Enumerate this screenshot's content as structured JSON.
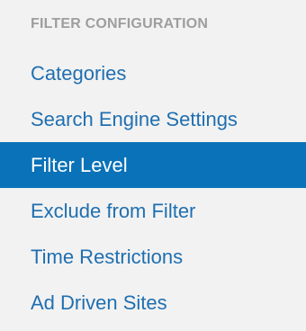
{
  "filter_menu": {
    "heading": "FILTER CONFIGURATION",
    "items": [
      {
        "label": "Categories",
        "active": false
      },
      {
        "label": "Search Engine Settings",
        "active": false
      },
      {
        "label": "Filter Level",
        "active": true
      },
      {
        "label": "Exclude from Filter",
        "active": false
      },
      {
        "label": "Time Restrictions",
        "active": false
      },
      {
        "label": "Ad Driven Sites",
        "active": false
      }
    ]
  },
  "colors": {
    "panel_background": "#f2f2f2",
    "heading_text": "#9e9e9e",
    "link_text": "#1f6fb0",
    "active_background": "#0a72b8",
    "active_text": "#ffffff"
  }
}
